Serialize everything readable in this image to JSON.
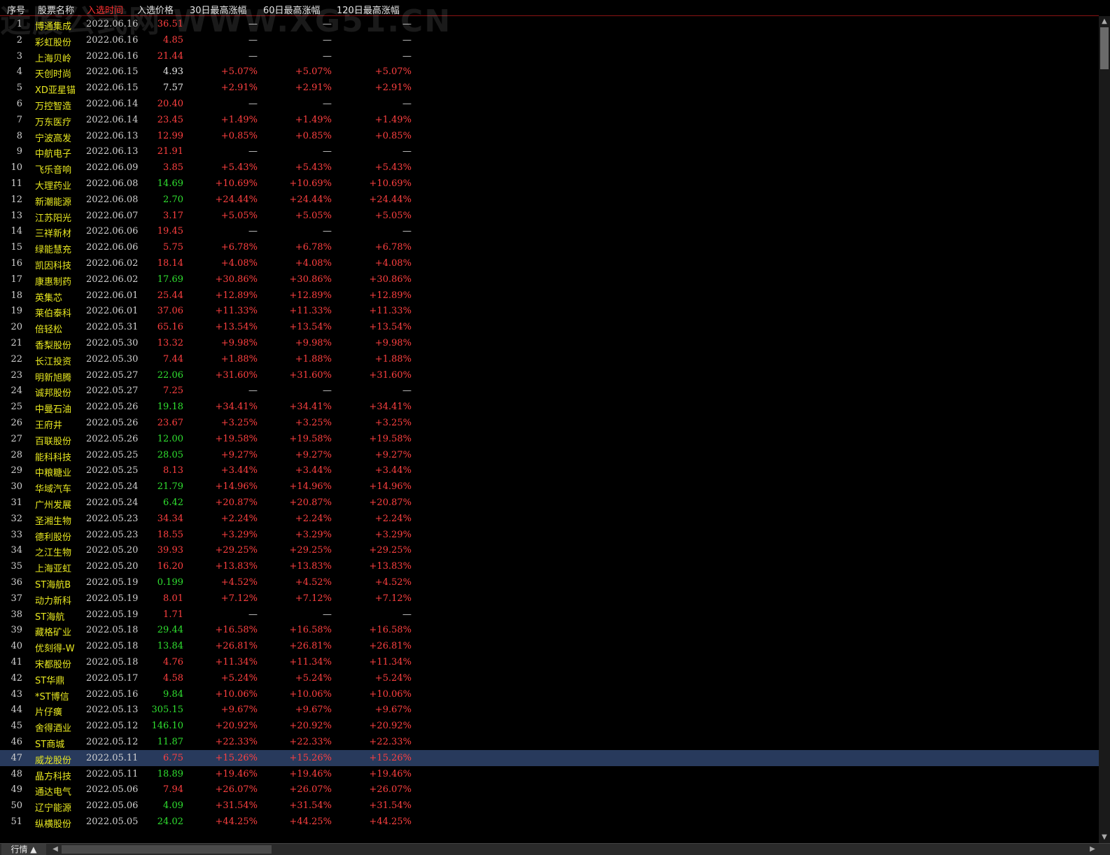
{
  "watermark": "选股公式网 WWW.XG51.CN",
  "header": {
    "columns": [
      "序号",
      "股票名称",
      "入选时间",
      "入选价格",
      "30日最高涨幅",
      "60日最高涨幅",
      "120日最高涨幅"
    ],
    "active_column": "入选时间"
  },
  "colors": {
    "red": "#ff4040",
    "green": "#30e030",
    "yellow": "#e8e820",
    "selected_bg": "#283a5c"
  },
  "rows": [
    {
      "idx": "1",
      "name": "博通集成",
      "date": "2022.06.16",
      "price": "36.51",
      "price_color": "red",
      "g30": "—",
      "g60": "—",
      "g120": "—"
    },
    {
      "idx": "2",
      "name": "彩虹股份",
      "date": "2022.06.16",
      "price": "4.85",
      "price_color": "red",
      "g30": "—",
      "g60": "—",
      "g120": "—"
    },
    {
      "idx": "3",
      "name": "上海贝岭",
      "date": "2022.06.16",
      "price": "21.44",
      "price_color": "red",
      "g30": "—",
      "g60": "—",
      "g120": "—"
    },
    {
      "idx": "4",
      "name": "天创时尚",
      "date": "2022.06.15",
      "price": "4.93",
      "price_color": "white",
      "g30": "+5.07%",
      "g60": "+5.07%",
      "g120": "+5.07%"
    },
    {
      "idx": "5",
      "name": "XD亚星锚",
      "date": "2022.06.15",
      "price": "7.57",
      "price_color": "white",
      "g30": "+2.91%",
      "g60": "+2.91%",
      "g120": "+2.91%"
    },
    {
      "idx": "6",
      "name": "万控智造",
      "date": "2022.06.14",
      "price": "20.40",
      "price_color": "red",
      "g30": "—",
      "g60": "—",
      "g120": "—"
    },
    {
      "idx": "7",
      "name": "万东医疗",
      "date": "2022.06.14",
      "price": "23.45",
      "price_color": "red",
      "g30": "+1.49%",
      "g60": "+1.49%",
      "g120": "+1.49%"
    },
    {
      "idx": "8",
      "name": "宁波高发",
      "date": "2022.06.13",
      "price": "12.99",
      "price_color": "red",
      "g30": "+0.85%",
      "g60": "+0.85%",
      "g120": "+0.85%"
    },
    {
      "idx": "9",
      "name": "中航电子",
      "date": "2022.06.13",
      "price": "21.91",
      "price_color": "red",
      "g30": "—",
      "g60": "—",
      "g120": "—"
    },
    {
      "idx": "10",
      "name": "飞乐音响",
      "date": "2022.06.09",
      "price": "3.85",
      "price_color": "red",
      "g30": "+5.43%",
      "g60": "+5.43%",
      "g120": "+5.43%"
    },
    {
      "idx": "11",
      "name": "大理药业",
      "date": "2022.06.08",
      "price": "14.69",
      "price_color": "green",
      "g30": "+10.69%",
      "g60": "+10.69%",
      "g120": "+10.69%"
    },
    {
      "idx": "12",
      "name": "新潮能源",
      "date": "2022.06.08",
      "price": "2.70",
      "price_color": "green",
      "g30": "+24.44%",
      "g60": "+24.44%",
      "g120": "+24.44%"
    },
    {
      "idx": "13",
      "name": "江苏阳光",
      "date": "2022.06.07",
      "price": "3.17",
      "price_color": "red",
      "g30": "+5.05%",
      "g60": "+5.05%",
      "g120": "+5.05%"
    },
    {
      "idx": "14",
      "name": "三祥新材",
      "date": "2022.06.06",
      "price": "19.45",
      "price_color": "red",
      "g30": "—",
      "g60": "—",
      "g120": "—"
    },
    {
      "idx": "15",
      "name": "绿能慧充",
      "date": "2022.06.06",
      "price": "5.75",
      "price_color": "red",
      "g30": "+6.78%",
      "g60": "+6.78%",
      "g120": "+6.78%"
    },
    {
      "idx": "16",
      "name": "凯因科技",
      "date": "2022.06.02",
      "price": "18.14",
      "price_color": "red",
      "g30": "+4.08%",
      "g60": "+4.08%",
      "g120": "+4.08%"
    },
    {
      "idx": "17",
      "name": "康惠制药",
      "date": "2022.06.02",
      "price": "17.69",
      "price_color": "green",
      "g30": "+30.86%",
      "g60": "+30.86%",
      "g120": "+30.86%"
    },
    {
      "idx": "18",
      "name": "英集芯",
      "date": "2022.06.01",
      "price": "25.44",
      "price_color": "red",
      "g30": "+12.89%",
      "g60": "+12.89%",
      "g120": "+12.89%"
    },
    {
      "idx": "19",
      "name": "莱伯泰科",
      "date": "2022.06.01",
      "price": "37.06",
      "price_color": "red",
      "g30": "+11.33%",
      "g60": "+11.33%",
      "g120": "+11.33%"
    },
    {
      "idx": "20",
      "name": "倍轻松",
      "date": "2022.05.31",
      "price": "65.16",
      "price_color": "red",
      "g30": "+13.54%",
      "g60": "+13.54%",
      "g120": "+13.54%"
    },
    {
      "idx": "21",
      "name": "香梨股份",
      "date": "2022.05.30",
      "price": "13.32",
      "price_color": "red",
      "g30": "+9.98%",
      "g60": "+9.98%",
      "g120": "+9.98%"
    },
    {
      "idx": "22",
      "name": "长江投资",
      "date": "2022.05.30",
      "price": "7.44",
      "price_color": "red",
      "g30": "+1.88%",
      "g60": "+1.88%",
      "g120": "+1.88%"
    },
    {
      "idx": "23",
      "name": "明新旭腾",
      "date": "2022.05.27",
      "price": "22.06",
      "price_color": "green",
      "g30": "+31.60%",
      "g60": "+31.60%",
      "g120": "+31.60%"
    },
    {
      "idx": "24",
      "name": "诚邦股份",
      "date": "2022.05.27",
      "price": "7.25",
      "price_color": "red",
      "g30": "—",
      "g60": "—",
      "g120": "—"
    },
    {
      "idx": "25",
      "name": "中曼石油",
      "date": "2022.05.26",
      "price": "19.18",
      "price_color": "green",
      "g30": "+34.41%",
      "g60": "+34.41%",
      "g120": "+34.41%"
    },
    {
      "idx": "26",
      "name": "王府井",
      "date": "2022.05.26",
      "price": "23.67",
      "price_color": "red",
      "g30": "+3.25%",
      "g60": "+3.25%",
      "g120": "+3.25%"
    },
    {
      "idx": "27",
      "name": "百联股份",
      "date": "2022.05.26",
      "price": "12.00",
      "price_color": "green",
      "g30": "+19.58%",
      "g60": "+19.58%",
      "g120": "+19.58%"
    },
    {
      "idx": "28",
      "name": "能科科技",
      "date": "2022.05.25",
      "price": "28.05",
      "price_color": "green",
      "g30": "+9.27%",
      "g60": "+9.27%",
      "g120": "+9.27%"
    },
    {
      "idx": "29",
      "name": "中粮糖业",
      "date": "2022.05.25",
      "price": "8.13",
      "price_color": "red",
      "g30": "+3.44%",
      "g60": "+3.44%",
      "g120": "+3.44%"
    },
    {
      "idx": "30",
      "name": "华域汽车",
      "date": "2022.05.24",
      "price": "21.79",
      "price_color": "green",
      "g30": "+14.96%",
      "g60": "+14.96%",
      "g120": "+14.96%"
    },
    {
      "idx": "31",
      "name": "广州发展",
      "date": "2022.05.24",
      "price": "6.42",
      "price_color": "green",
      "g30": "+20.87%",
      "g60": "+20.87%",
      "g120": "+20.87%"
    },
    {
      "idx": "32",
      "name": "圣湘生物",
      "date": "2022.05.23",
      "price": "34.34",
      "price_color": "red",
      "g30": "+2.24%",
      "g60": "+2.24%",
      "g120": "+2.24%"
    },
    {
      "idx": "33",
      "name": "德利股份",
      "date": "2022.05.23",
      "price": "18.55",
      "price_color": "red",
      "g30": "+3.29%",
      "g60": "+3.29%",
      "g120": "+3.29%"
    },
    {
      "idx": "34",
      "name": "之江生物",
      "date": "2022.05.20",
      "price": "39.93",
      "price_color": "red",
      "g30": "+29.25%",
      "g60": "+29.25%",
      "g120": "+29.25%"
    },
    {
      "idx": "35",
      "name": "上海亚虹",
      "date": "2022.05.20",
      "price": "16.20",
      "price_color": "red",
      "g30": "+13.83%",
      "g60": "+13.83%",
      "g120": "+13.83%"
    },
    {
      "idx": "36",
      "name": "ST海航B",
      "date": "2022.05.19",
      "price": "0.199",
      "price_color": "green",
      "g30": "+4.52%",
      "g60": "+4.52%",
      "g120": "+4.52%"
    },
    {
      "idx": "37",
      "name": "动力新科",
      "date": "2022.05.19",
      "price": "8.01",
      "price_color": "red",
      "g30": "+7.12%",
      "g60": "+7.12%",
      "g120": "+7.12%"
    },
    {
      "idx": "38",
      "name": "ST海航",
      "date": "2022.05.19",
      "price": "1.71",
      "price_color": "red",
      "g30": "—",
      "g60": "—",
      "g120": "—"
    },
    {
      "idx": "39",
      "name": "藏格矿业",
      "date": "2022.05.18",
      "price": "29.44",
      "price_color": "green",
      "g30": "+16.58%",
      "g60": "+16.58%",
      "g120": "+16.58%"
    },
    {
      "idx": "40",
      "name": "优刻得-W",
      "date": "2022.05.18",
      "price": "13.84",
      "price_color": "green",
      "g30": "+26.81%",
      "g60": "+26.81%",
      "g120": "+26.81%"
    },
    {
      "idx": "41",
      "name": "宋都股份",
      "date": "2022.05.18",
      "price": "4.76",
      "price_color": "red",
      "g30": "+11.34%",
      "g60": "+11.34%",
      "g120": "+11.34%"
    },
    {
      "idx": "42",
      "name": "ST华鼎",
      "date": "2022.05.17",
      "price": "4.58",
      "price_color": "red",
      "g30": "+5.24%",
      "g60": "+5.24%",
      "g120": "+5.24%"
    },
    {
      "idx": "43",
      "name": "*ST博信",
      "date": "2022.05.16",
      "price": "9.84",
      "price_color": "green",
      "g30": "+10.06%",
      "g60": "+10.06%",
      "g120": "+10.06%"
    },
    {
      "idx": "44",
      "name": "片仔癀",
      "date": "2022.05.13",
      "price": "305.15",
      "price_color": "green",
      "g30": "+9.67%",
      "g60": "+9.67%",
      "g120": "+9.67%"
    },
    {
      "idx": "45",
      "name": "舍得酒业",
      "date": "2022.05.12",
      "price": "146.10",
      "price_color": "green",
      "g30": "+20.92%",
      "g60": "+20.92%",
      "g120": "+20.92%"
    },
    {
      "idx": "46",
      "name": "ST商城",
      "date": "2022.05.12",
      "price": "11.87",
      "price_color": "green",
      "g30": "+22.33%",
      "g60": "+22.33%",
      "g120": "+22.33%"
    },
    {
      "idx": "47",
      "name": "威龙股份",
      "date": "2022.05.11",
      "price": "6.75",
      "price_color": "red",
      "g30": "+15.26%",
      "g60": "+15.26%",
      "g120": "+15.26%",
      "selected": true
    },
    {
      "idx": "48",
      "name": "晶方科技",
      "date": "2022.05.11",
      "price": "18.89",
      "price_color": "green",
      "g30": "+19.46%",
      "g60": "+19.46%",
      "g120": "+19.46%"
    },
    {
      "idx": "49",
      "name": "通达电气",
      "date": "2022.05.06",
      "price": "7.94",
      "price_color": "red",
      "g30": "+26.07%",
      "g60": "+26.07%",
      "g120": "+26.07%"
    },
    {
      "idx": "50",
      "name": "辽宁能源",
      "date": "2022.05.06",
      "price": "4.09",
      "price_color": "green",
      "g30": "+31.54%",
      "g60": "+31.54%",
      "g120": "+31.54%"
    },
    {
      "idx": "51",
      "name": "纵横股份",
      "date": "2022.05.05",
      "price": "24.02",
      "price_color": "green",
      "g30": "+44.25%",
      "g60": "+44.25%",
      "g120": "+44.25%"
    }
  ],
  "bottom_bar": {
    "tab_label": "行情 ▲"
  }
}
